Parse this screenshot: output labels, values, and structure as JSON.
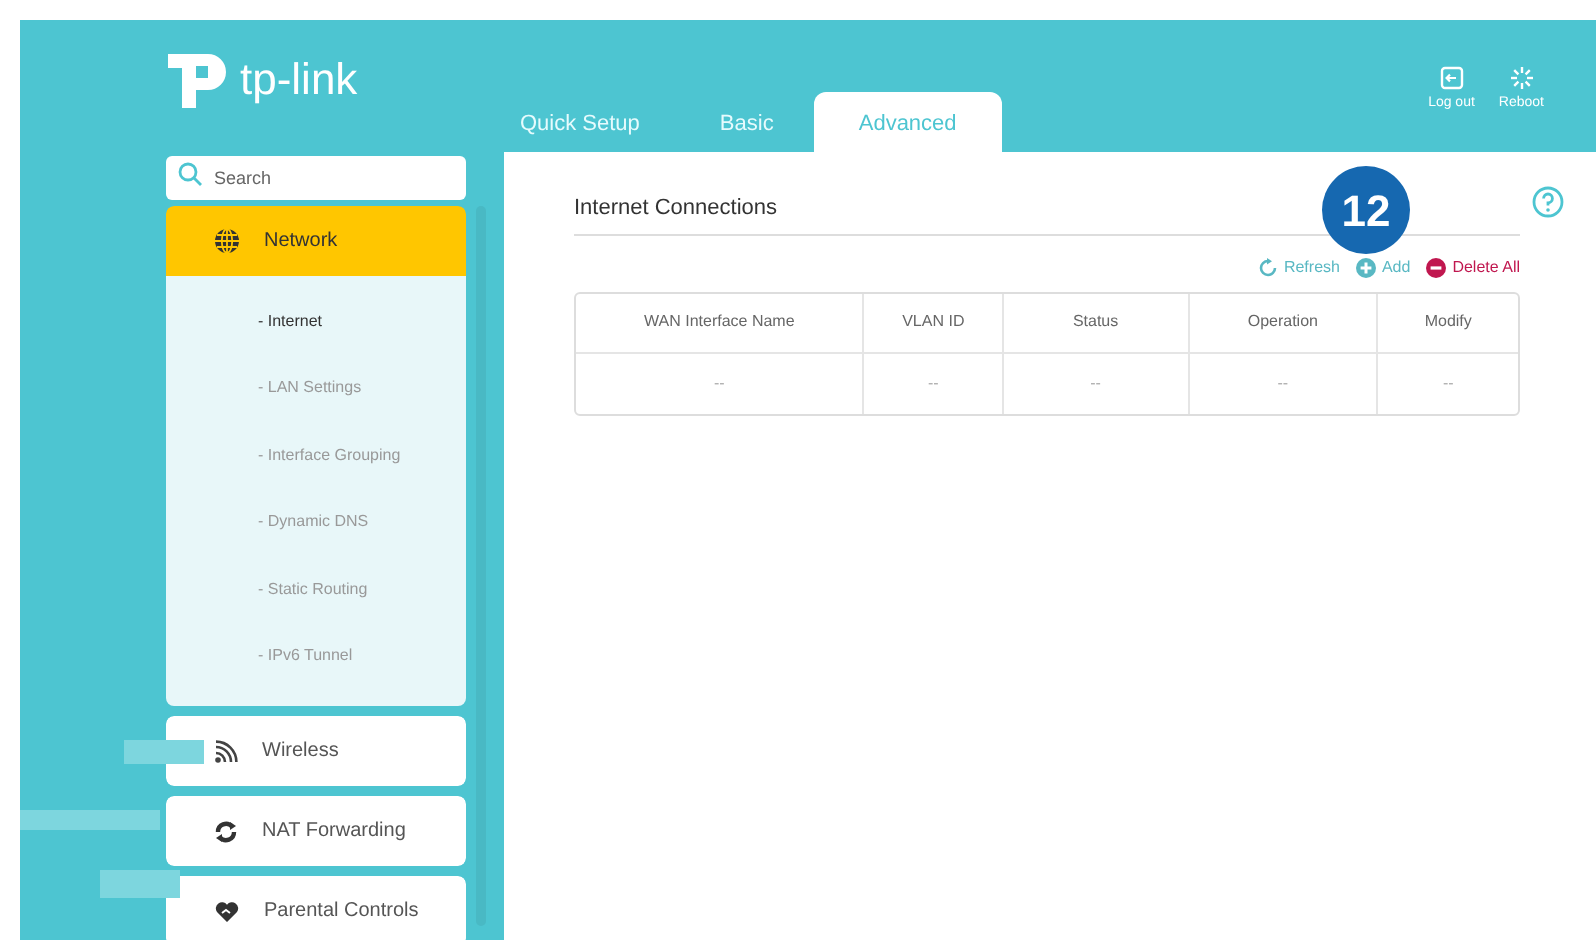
{
  "logo": {
    "text": "tp-link"
  },
  "tabs": [
    {
      "label": "Quick Setup",
      "selected": false
    },
    {
      "label": "Basic",
      "selected": false
    },
    {
      "label": "Advanced",
      "selected": true
    }
  ],
  "header_actions": [
    {
      "kind": "logout",
      "label": "Log out"
    },
    {
      "kind": "reboot",
      "label": "Reboot"
    }
  ],
  "search": {
    "placeholder": "Search"
  },
  "sidebar": {
    "items": [
      {
        "kind": "globe",
        "label": "Network",
        "selected": true,
        "expanded": true,
        "children": [
          {
            "label": "- Internet",
            "selected": true
          },
          {
            "label": "- LAN Settings",
            "selected": false
          },
          {
            "label": "- Interface Grouping",
            "selected": false
          },
          {
            "label": "- Dynamic DNS",
            "selected": false
          },
          {
            "label": "- Static Routing",
            "selected": false
          },
          {
            "label": "- IPv6 Tunnel",
            "selected": false
          }
        ]
      },
      {
        "kind": "wifi",
        "label": "Wireless",
        "selected": false
      },
      {
        "kind": "nat",
        "label": "NAT Forwarding",
        "selected": false
      },
      {
        "kind": "heart",
        "label": "Parental Controls",
        "selected": false
      }
    ]
  },
  "panel": {
    "title": "Internet Connections",
    "callout": "12"
  },
  "toolbar": [
    {
      "kind": "refresh",
      "label": "Refresh"
    },
    {
      "kind": "add",
      "label": "Add"
    },
    {
      "kind": "delete",
      "label": "Delete All"
    }
  ],
  "table": {
    "columns": [
      "WAN Interface Name",
      "VLAN ID",
      "Status",
      "Operation",
      "Modify"
    ],
    "rows": [
      [
        "--",
        "--",
        "--",
        "--",
        "--"
      ]
    ]
  }
}
